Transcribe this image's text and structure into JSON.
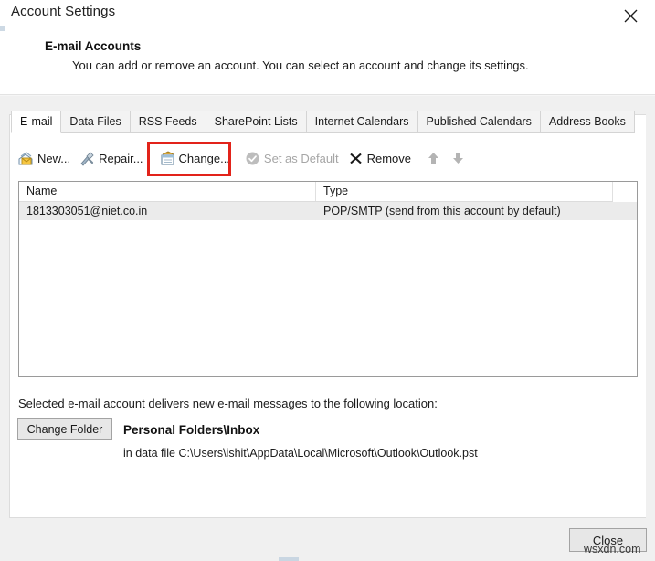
{
  "window": {
    "title": "Account Settings",
    "close_icon": "close-x-icon"
  },
  "instruction": {
    "heading": "E-mail Accounts",
    "text": "You can add or remove an account. You can select an account and change its settings."
  },
  "tabs": [
    {
      "label": "E-mail",
      "active": true
    },
    {
      "label": "Data Files",
      "active": false
    },
    {
      "label": "RSS Feeds",
      "active": false
    },
    {
      "label": "SharePoint Lists",
      "active": false
    },
    {
      "label": "Internet Calendars",
      "active": false
    },
    {
      "label": "Published Calendars",
      "active": false
    },
    {
      "label": "Address Books",
      "active": false
    }
  ],
  "toolbar": {
    "new_label": "New...",
    "repair_label": "Repair...",
    "change_label": "Change...",
    "set_default_label": "Set as Default",
    "remove_label": "Remove",
    "move_up_icon": "arrow-up-icon",
    "move_down_icon": "arrow-down-icon",
    "new_icon": "new-account-icon",
    "repair_icon": "repair-tools-icon",
    "change_icon": "change-account-icon",
    "set_default_icon": "check-circle-icon",
    "remove_icon": "x-remove-icon"
  },
  "highlight": {
    "target": "change-button",
    "color": "#e2231a"
  },
  "accounts_list": {
    "columns": [
      "Name",
      "Type"
    ],
    "rows": [
      {
        "name": "1813303051@niet.co.in",
        "type": "POP/SMTP (send from this account by default)",
        "selected": true
      }
    ]
  },
  "delivery": {
    "description": "Selected e-mail account delivers new e-mail messages to the following location:",
    "change_folder_label": "Change Folder",
    "folder": "Personal Folders\\Inbox",
    "data_file": "in data file C:\\Users\\ishit\\AppData\\Local\\Microsoft\\Outlook\\Outlook.pst"
  },
  "footer": {
    "close_label": "Close"
  },
  "watermark": {
    "text": "wsxdn.com"
  }
}
